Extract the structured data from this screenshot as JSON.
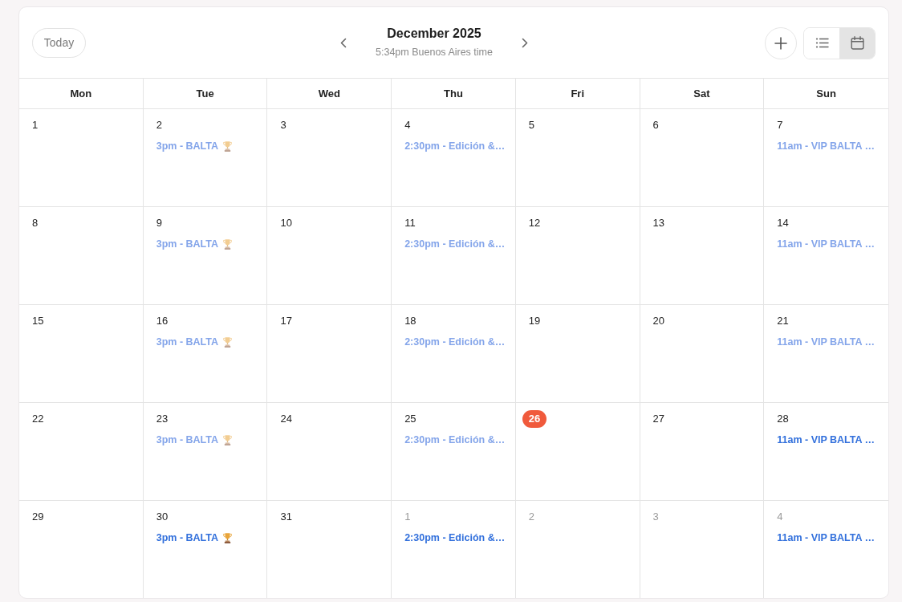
{
  "toolbar": {
    "today_button": "Today",
    "title": "December 2025",
    "subtitle": "5:34pm Buenos Aires time",
    "views": [
      {
        "kind": "list",
        "selected": false
      },
      {
        "kind": "calendar",
        "selected": true
      }
    ]
  },
  "weekdays": [
    "Mon",
    "Tue",
    "Wed",
    "Thu",
    "Fri",
    "Sat",
    "Sun"
  ],
  "weeks": [
    {
      "days": [
        {
          "day": "1",
          "today": false,
          "other_month": false
        },
        {
          "day": "2",
          "today": false,
          "other_month": false,
          "events": [
            {
              "label": "3pm - BALTA",
              "trophy": true,
              "past": true
            }
          ]
        },
        {
          "day": "3",
          "today": false,
          "other_month": false
        },
        {
          "day": "4",
          "today": false,
          "other_month": false,
          "events": [
            {
              "label": "2:30pm - Edición &…",
              "trophy": false,
              "past": true
            }
          ]
        },
        {
          "day": "5",
          "today": false,
          "other_month": false
        },
        {
          "day": "6",
          "today": false,
          "other_month": false
        },
        {
          "day": "7",
          "today": false,
          "other_month": false,
          "events": [
            {
              "label": "11am - VIP BALTA …",
              "trophy": false,
              "past": true
            }
          ]
        }
      ]
    },
    {
      "days": [
        {
          "day": "8",
          "today": false,
          "other_month": false
        },
        {
          "day": "9",
          "today": false,
          "other_month": false,
          "events": [
            {
              "label": "3pm - BALTA",
              "trophy": true,
              "past": true
            }
          ]
        },
        {
          "day": "10",
          "today": false,
          "other_month": false
        },
        {
          "day": "11",
          "today": false,
          "other_month": false,
          "events": [
            {
              "label": "2:30pm - Edición &…",
              "trophy": false,
              "past": true
            }
          ]
        },
        {
          "day": "12",
          "today": false,
          "other_month": false
        },
        {
          "day": "13",
          "today": false,
          "other_month": false
        },
        {
          "day": "14",
          "today": false,
          "other_month": false,
          "events": [
            {
              "label": "11am - VIP BALTA …",
              "trophy": false,
              "past": true
            }
          ]
        }
      ]
    },
    {
      "days": [
        {
          "day": "15",
          "today": false,
          "other_month": false
        },
        {
          "day": "16",
          "today": false,
          "other_month": false,
          "events": [
            {
              "label": "3pm - BALTA",
              "trophy": true,
              "past": true
            }
          ]
        },
        {
          "day": "17",
          "today": false,
          "other_month": false
        },
        {
          "day": "18",
          "today": false,
          "other_month": false,
          "events": [
            {
              "label": "2:30pm - Edición &…",
              "trophy": false,
              "past": true
            }
          ]
        },
        {
          "day": "19",
          "today": false,
          "other_month": false
        },
        {
          "day": "20",
          "today": false,
          "other_month": false
        },
        {
          "day": "21",
          "today": false,
          "other_month": false,
          "events": [
            {
              "label": "11am - VIP BALTA …",
              "trophy": false,
              "past": true
            }
          ]
        }
      ]
    },
    {
      "days": [
        {
          "day": "22",
          "today": false,
          "other_month": false
        },
        {
          "day": "23",
          "today": false,
          "other_month": false,
          "events": [
            {
              "label": "3pm - BALTA",
              "trophy": true,
              "past": true
            }
          ]
        },
        {
          "day": "24",
          "today": false,
          "other_month": false
        },
        {
          "day": "25",
          "today": false,
          "other_month": false,
          "events": [
            {
              "label": "2:30pm - Edición &…",
              "trophy": false,
              "past": true
            }
          ]
        },
        {
          "day": "26",
          "today": true,
          "other_month": false
        },
        {
          "day": "27",
          "today": false,
          "other_month": false
        },
        {
          "day": "28",
          "today": false,
          "other_month": false,
          "events": [
            {
              "label": "11am - VIP BALTA …",
              "trophy": false,
              "past": false
            }
          ]
        }
      ]
    },
    {
      "days": [
        {
          "day": "29",
          "today": false,
          "other_month": false
        },
        {
          "day": "30",
          "today": false,
          "other_month": false,
          "events": [
            {
              "label": "3pm - BALTA",
              "trophy": true,
              "past": false
            }
          ]
        },
        {
          "day": "31",
          "today": false,
          "other_month": false
        },
        {
          "day": "1",
          "today": false,
          "other_month": true,
          "events": [
            {
              "label": "2:30pm - Edición &…",
              "trophy": false,
              "past": false
            }
          ]
        },
        {
          "day": "2",
          "today": false,
          "other_month": true
        },
        {
          "day": "3",
          "today": false,
          "other_month": true
        },
        {
          "day": "4",
          "today": false,
          "other_month": true,
          "events": [
            {
              "label": "11am - VIP BALTA …",
              "trophy": false,
              "past": false
            }
          ]
        }
      ]
    }
  ]
}
